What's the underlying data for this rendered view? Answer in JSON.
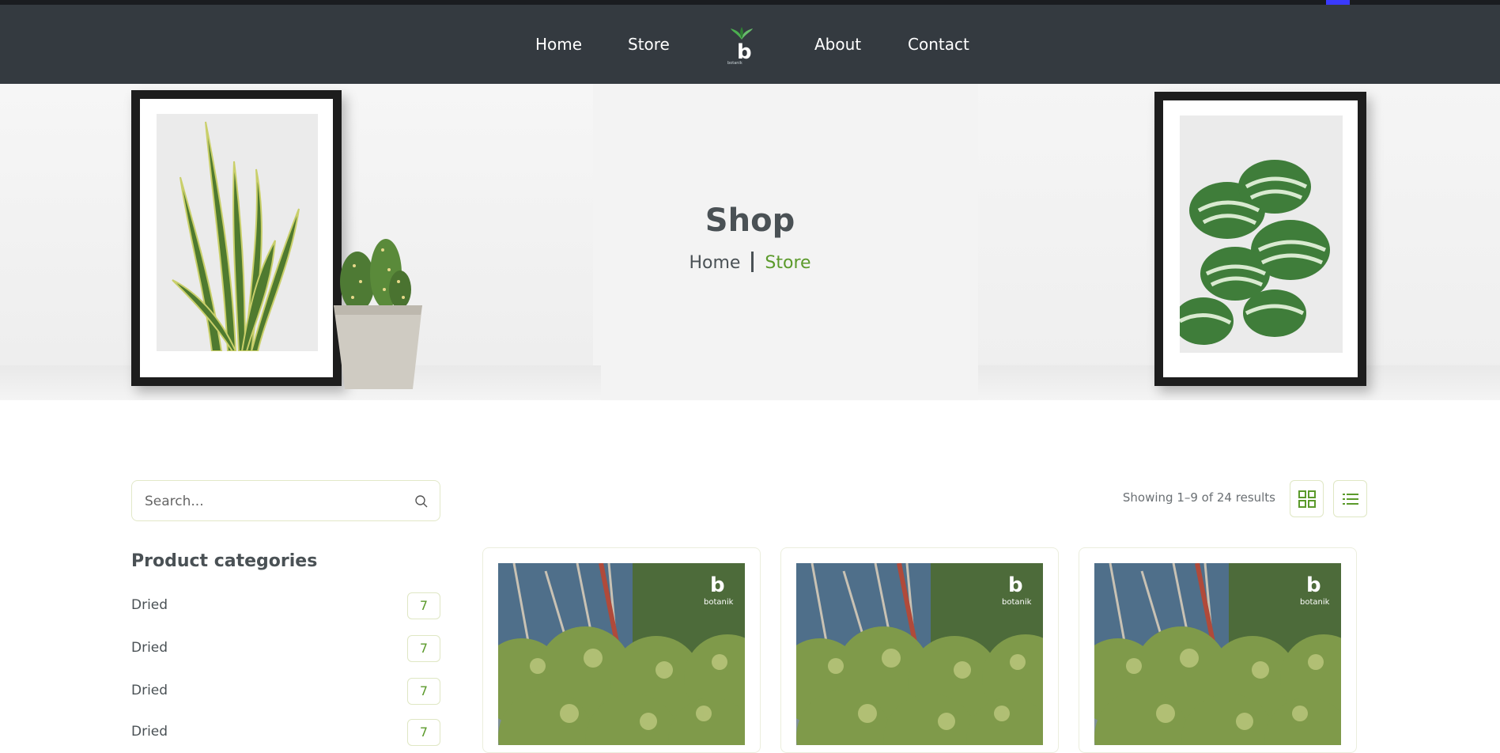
{
  "nav": {
    "links_left": [
      "Home",
      "Store"
    ],
    "links_right": [
      "About",
      "Contact"
    ],
    "logo_icon": "botanik-logo-icon"
  },
  "hero": {
    "title": "Shop",
    "breadcrumb": {
      "home": "Home",
      "current": "Store"
    }
  },
  "sidebar": {
    "search_placeholder": "Search...",
    "categories_title": "Product categories",
    "categories": [
      {
        "label": "Dried",
        "count": "7"
      },
      {
        "label": "Dried",
        "count": "7"
      },
      {
        "label": "Dried",
        "count": "7"
      },
      {
        "label": "Dried",
        "count": "7"
      }
    ]
  },
  "toolbar": {
    "results_text": "Showing 1–9 of 24 results",
    "grid_icon": "grid-view-icon",
    "list_icon": "list-view-icon"
  },
  "products": [
    {
      "image_icon": "product-photo",
      "brand": "botanik"
    },
    {
      "image_icon": "product-photo",
      "brand": "botanik"
    },
    {
      "image_icon": "product-photo",
      "brand": "botanik"
    }
  ],
  "colors": {
    "nav_bg": "#343a40",
    "accent_green": "#5b9a2b",
    "heading": "#4a5155",
    "hero_bg": "#f3f3f3"
  }
}
